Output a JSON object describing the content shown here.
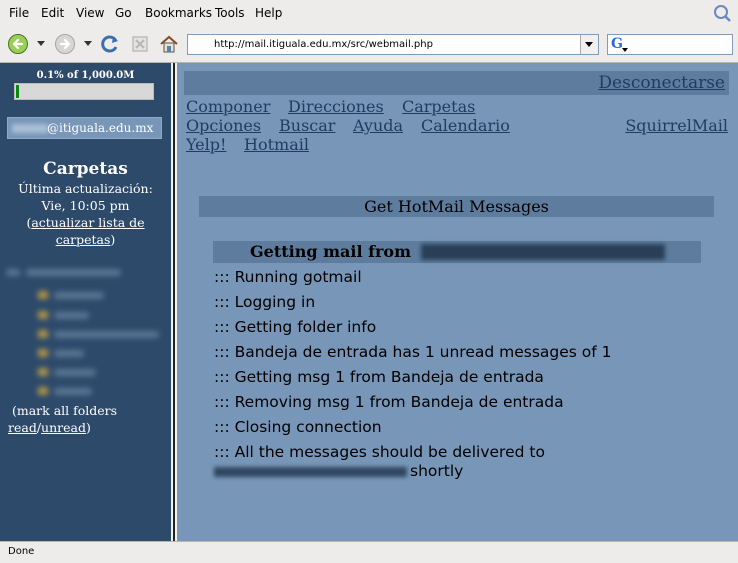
{
  "menu": [
    "File",
    "Edit",
    "View",
    "Go",
    "Bookmarks",
    "Tools",
    "Help"
  ],
  "toolbar": {
    "back_icon": "back-arrow-icon",
    "forward_icon": "forward-arrow-icon",
    "reload_icon": "reload-icon",
    "stop_icon": "stop-icon",
    "home_icon": "home-icon",
    "url": "http://mail.itiguala.edu.mx/src/webmail.php",
    "search_engine_icon": "google-icon"
  },
  "sidebar": {
    "quota_label": "0.1% of 1,000.0M",
    "quota_percent": 0.1,
    "email_domain": "@itiguala.edu.mx",
    "folders_title": "Carpetas",
    "last_update_label": "Última actualización:",
    "last_update_time": "Vie, 10:05 pm",
    "refresh_open": "(",
    "refresh_link_line1": "actualizar lista de",
    "refresh_link_line2": "carpetas",
    "refresh_close": ")",
    "mark_all_prefix": "(mark all folders",
    "mark_read": "read",
    "mark_sep": "/",
    "mark_unread": "unread",
    "mark_close": ")"
  },
  "nav": {
    "logout": "Desconectarse",
    "compose": "Componer",
    "addresses": "Direcciones",
    "folders": "Carpetas",
    "options": "Opciones",
    "search": "Buscar",
    "help": "Ayuda",
    "calendar": "Calendario",
    "squirrelmail": "SquirrelMail",
    "yelp": "Yelp!",
    "hotmail": "Hotmail"
  },
  "content": {
    "title": "Get HotMail Messages",
    "subtitle": "Getting mail from",
    "log": [
      "::: Running gotmail",
      "::: Logging in",
      "::: Getting folder info",
      "::: Bandeja de entrada has 1 unread messages of 1",
      "::: Getting msg 1 from Bandeja de entrada",
      "::: Removing msg 1 from Bandeja de entrada",
      "::: Closing connection",
      "::: All the messages should be delivered to"
    ],
    "delivered_suffix": "shortly"
  },
  "status": "Done",
  "colors": {
    "sidebar_bg": "#2d4a6b",
    "main_bg": "#7896b8",
    "header_bg": "#5d7c9e",
    "link": "#1f3d60",
    "quota_fill": "#0a8a0a"
  }
}
